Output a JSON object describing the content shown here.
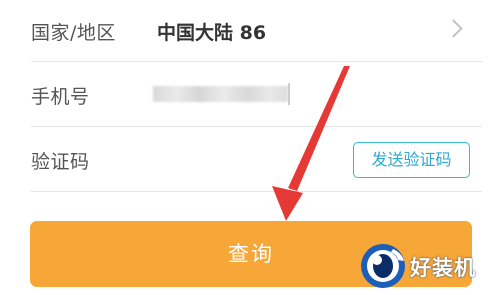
{
  "form": {
    "region": {
      "label": "国家/地区",
      "value": "中国大陆 86"
    },
    "phone": {
      "label": "手机号"
    },
    "code": {
      "label": "验证码",
      "send_button": "发送验证码"
    },
    "submit_button": "查询"
  },
  "watermark": {
    "text": "好装机"
  },
  "colors": {
    "accent_orange": "#f6a738",
    "send_button_blue": "#34b7d9",
    "annotation_arrow": "#e53935"
  },
  "icons": {
    "region_chevron": "chevron-right-icon",
    "annotation": "red-arrow-icon"
  }
}
